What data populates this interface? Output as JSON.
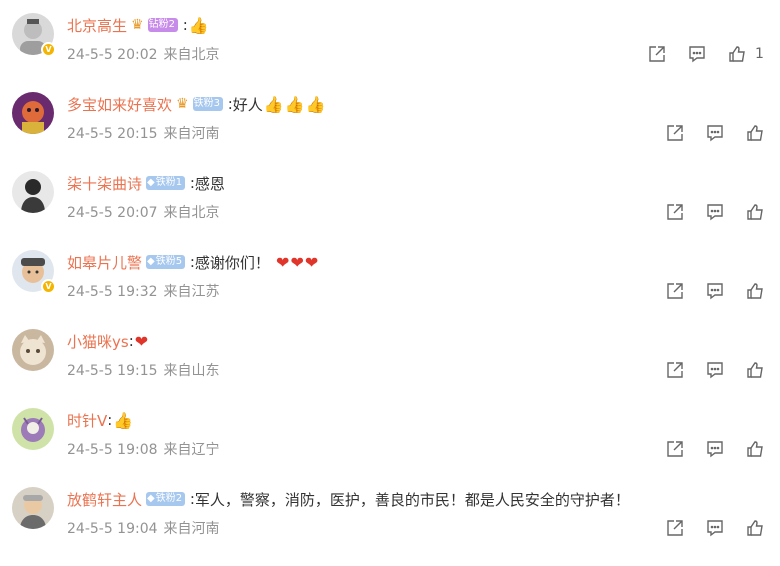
{
  "comments": [
    {
      "user": "北京高生",
      "fan_badge": "钻粉2",
      "fan_type": "diamond",
      "text": "",
      "emoji": [
        "👍"
      ],
      "emoji_type": "thumb",
      "date": "24-5-5 20:02",
      "source": "来自北京",
      "likes": "1",
      "verified": true
    },
    {
      "user": "多宝如来好喜欢",
      "fan_badge": "铁粉3",
      "fan_type": "iron-crown",
      "text": "好人",
      "emoji": [
        "👍",
        "👍",
        "👍"
      ],
      "emoji_type": "thumb",
      "date": "24-5-5 20:15",
      "source": "来自河南",
      "likes": "",
      "verified": false
    },
    {
      "user": "柒十柒曲诗",
      "fan_badge": "铁粉1",
      "fan_type": "iron",
      "text": "感恩",
      "emoji": [],
      "emoji_type": "",
      "date": "24-5-5 20:07",
      "source": "来自北京",
      "likes": "",
      "verified": false
    },
    {
      "user": "如皋片儿警",
      "fan_badge": "铁粉5",
      "fan_type": "iron",
      "text": "感谢你们！",
      "emoji": [
        "❤",
        "❤",
        "❤"
      ],
      "emoji_type": "heart",
      "date": "24-5-5 19:32",
      "source": "来自江苏",
      "likes": "",
      "verified": true
    },
    {
      "user": "小猫咪ys",
      "fan_badge": "",
      "fan_type": "",
      "text": "",
      "emoji": [
        "❤"
      ],
      "emoji_type": "heart",
      "date": "24-5-5 19:15",
      "source": "来自山东",
      "likes": "",
      "verified": false
    },
    {
      "user": "时针V",
      "fan_badge": "",
      "fan_type": "",
      "text": "",
      "emoji": [
        "👍"
      ],
      "emoji_type": "thumb",
      "date": "24-5-5 19:08",
      "source": "来自辽宁",
      "likes": "",
      "verified": false
    },
    {
      "user": "放鹤轩主人",
      "fan_badge": "铁粉2",
      "fan_type": "iron",
      "text": "军人，警察，消防，医护，善良的市民！都是人民安全的守护者！",
      "emoji": [],
      "emoji_type": "",
      "date": "24-5-5 19:04",
      "source": "来自河南",
      "likes": "",
      "verified": false
    }
  ],
  "icons": {
    "share": "share-icon",
    "reply": "comment-icon",
    "like": "thumbs-up-icon",
    "verified": "verified-badge-icon"
  },
  "colors": {
    "username": "#eb7350",
    "meta": "#939393",
    "icon": "#666666",
    "diamond_badge": "#c78be9",
    "iron_badge": "#a6c7ee"
  }
}
